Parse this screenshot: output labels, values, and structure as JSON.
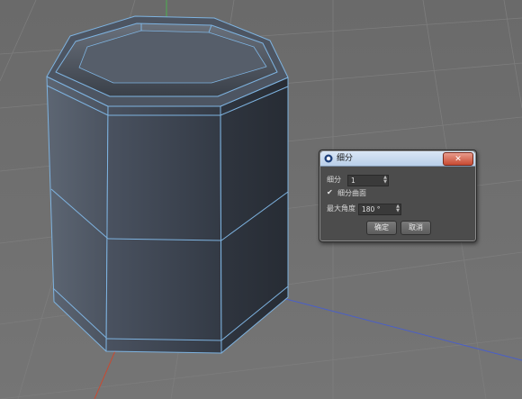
{
  "dialog": {
    "title": "细分",
    "close_label": "✕",
    "subdivision_label": "细分",
    "subdivision_value": "1",
    "subdivide_surface_label": "细分曲面",
    "subdivide_surface_checked": true,
    "max_angle_label": "最大角度",
    "max_angle_value": "180 °",
    "ok_label": "确定",
    "cancel_label": "取消"
  },
  "icons": {
    "title_icon": "c4d-logo-icon",
    "close_icon": "close-icon",
    "check_icon": "checkmark-icon",
    "spin_icon": "spin-arrows-icon"
  },
  "colors": {
    "viewport_bg": "#6e6e6e",
    "model_face": "#3d4551",
    "wire": "#7eb3e0",
    "dialog_bg": "#4c4c4c",
    "titlebar": "#c8d8ee",
    "close": "#c84a32"
  }
}
